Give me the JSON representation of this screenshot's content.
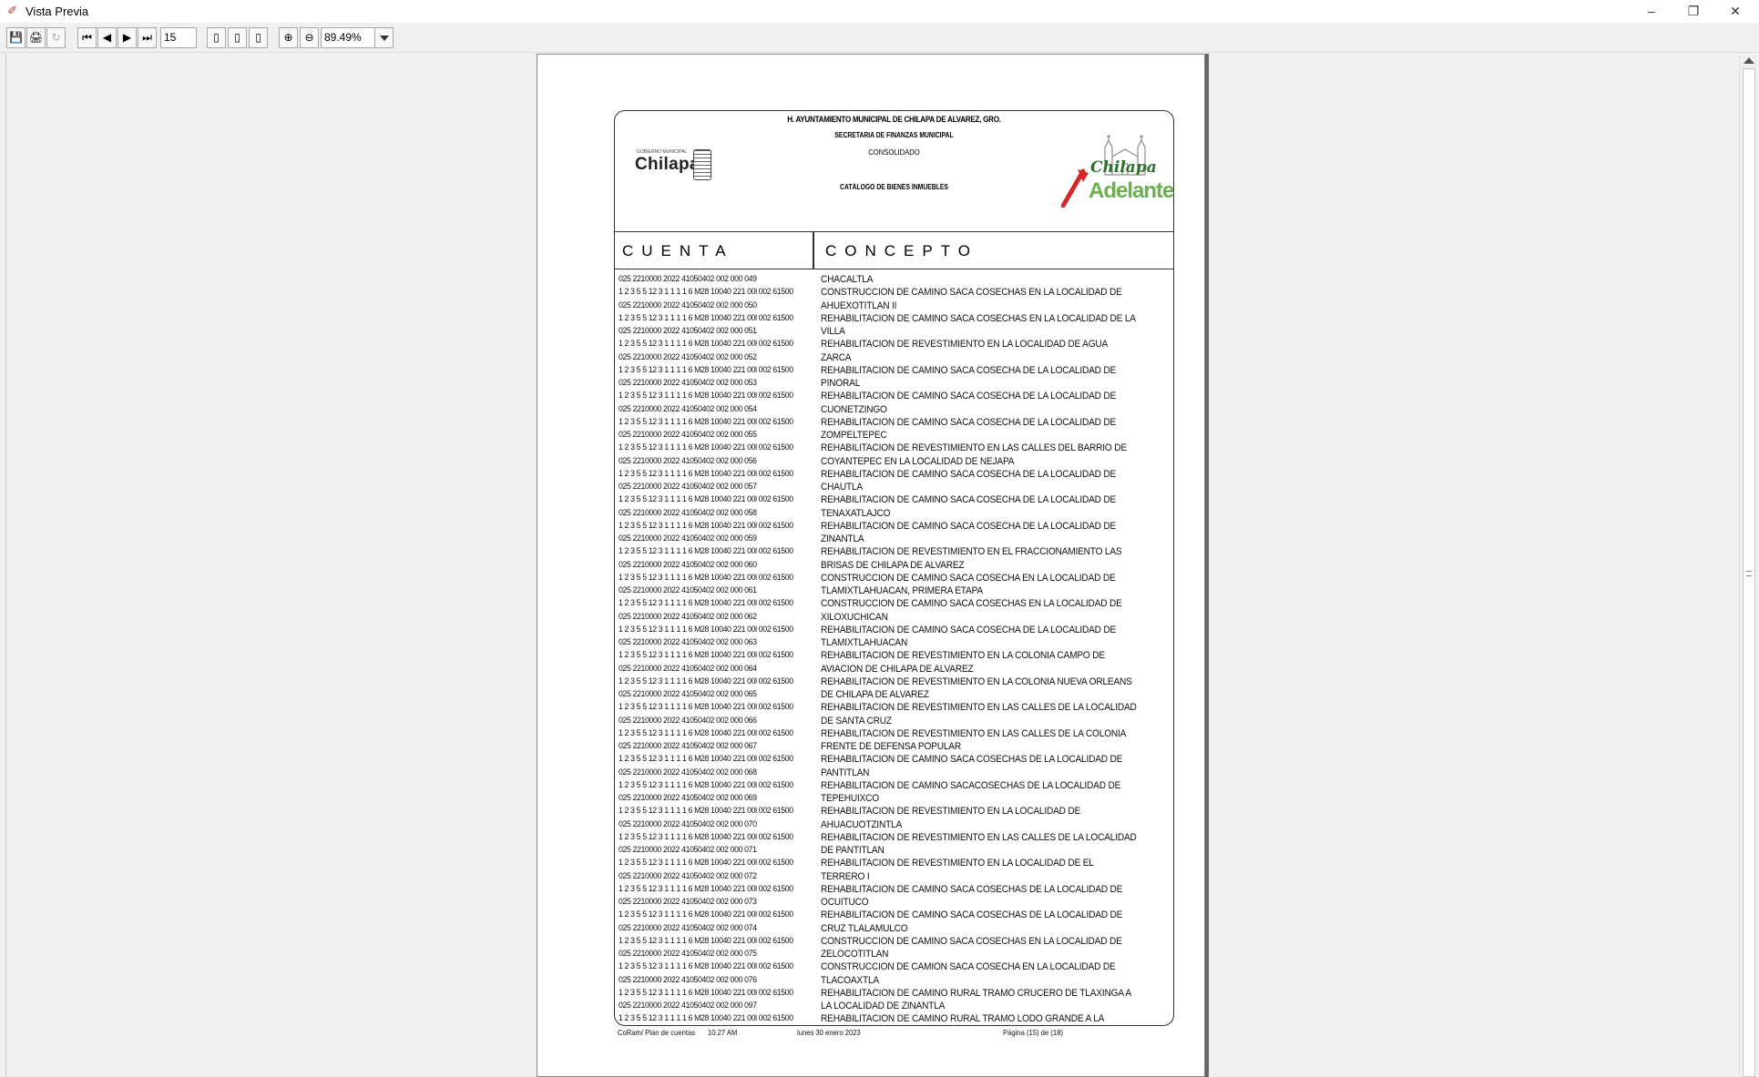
{
  "window": {
    "title": "Vista Previa",
    "minimize": "–",
    "restore": "❐",
    "close": "✕"
  },
  "toolbar": {
    "save": "💾",
    "print": "🖨",
    "refresh": "↻",
    "first": "⏮",
    "prev": "◀",
    "next": "▶",
    "last": "⏭",
    "page_number": "15",
    "single_page": "▯",
    "page_width": "▯",
    "multi_page": "▯",
    "zoom_in": "⊕",
    "zoom_out": "⊖",
    "zoom_value": "89.49%"
  },
  "report": {
    "header_line1": "H. AYUNTAMIENTO MUNICIPAL DE CHILAPA DE ALVAREZ, GRO.",
    "header_line2": "SECRETARIA DE FINANZAS MUNICIPAL",
    "header_line3": "CONSOLIDADO",
    "header_line4": "CATÁLOGO DE BIENES INMUEBLES",
    "logo_left_tagline": "GOBIERNO MUNICIPAL",
    "logo_left_word": "Chilapa",
    "logo_right_script": "Chilapa",
    "logo_right_word": "Adelante",
    "col_cuenta": "CUENTA",
    "col_concepto": "CONCEPTO",
    "rows": [
      {
        "acc1": "025 2210000 2022 41050402 002 000 049",
        "acc2": "1 2 3 5 5 12 3 1 1 1 1 6 M28 10040 221 00l 002 61500",
        "con1": "CHACALTLA",
        "con2": "CONSTRUCCION DE CAMINO SACA COSECHAS EN LA LOCALIDAD DE"
      },
      {
        "acc1": "025 2210000 2022 41050402 002 000 050",
        "acc2": "1 2 3 5 5 12 3 1 1 1 1 6 M28 10040 221 00l 002 61500",
        "con1": "AHUEXOTITLAN II",
        "con2": "REHABILITACION DE CAMINO SACA COSECHAS EN LA LOCALIDAD DE LA"
      },
      {
        "acc1": "025 2210000 2022 41050402 002 000 051",
        "acc2": "1 2 3 5 5 12 3 1 1 1 1 6 M28 10040 221 00l 002 61500",
        "con1": "VILLA",
        "con2": "REHABILITACION DE REVESTIMIENTO EN LA  LOCALIDAD DE AGUA"
      },
      {
        "acc1": "025 2210000 2022 41050402 002 000 052",
        "acc2": "1 2 3 5 5 12 3 1 1 1 1 6 M28 10040 221 00l 002 61500",
        "con1": "ZARCA",
        "con2": "REHABILITACION DE CAMINO SACA COSECHA DE LA LOCALIDAD DE"
      },
      {
        "acc1": "025 2210000 2022 41050402 002 000 053",
        "acc2": "1 2 3 5 5 12 3 1 1 1 1 6 M28 10040 221 00l 002 61500",
        "con1": "PINORAL",
        "con2": "REHABILITACION DE CAMINO SACA COSECHA DE LA LOCALIDAD DE"
      },
      {
        "acc1": "025 2210000 2022 41050402 002 000 054",
        "acc2": "1 2 3 5 5 12 3 1 1 1 1 6 M28 10040 221 00l 002 61500",
        "con1": "CUONETZINGO",
        "con2": "REHABILITACION DE CAMINO SACA COSECHA DE LA LOCALIDAD DE"
      },
      {
        "acc1": "025 2210000 2022 41050402 002 000 055",
        "acc2": "1 2 3 5 5 12 3 1 1 1 1 6 M28 10040 221 00l 002 61500",
        "con1": "ZOMPELTEPEC",
        "con2": "REHABILITACION DE REVESTIMIENTO EN LAS CALLES DEL BARRIO DE"
      },
      {
        "acc1": "025 2210000 2022 41050402 002 000 056",
        "acc2": "1 2 3 5 5 12 3 1 1 1 1 6 M28 10040 221 00l 002 61500",
        "con1": "COYANTEPEC EN LA LOCALIDAD DE NEJAPA",
        "con2": "REHABILITACION DE CAMINO SACA COSECHA DE LA LOCALIDAD DE"
      },
      {
        "acc1": "025 2210000 2022 41050402 002 000 057",
        "acc2": "1 2 3 5 5 12 3 1 1 1 1 6 M28 10040 221 00l 002 61500",
        "con1": "CHAUTLA",
        "con2": "REHABILITACION DE CAMINO SACA COSECHA DE LA LOCALIDAD DE"
      },
      {
        "acc1": "025 2210000 2022 41050402 002 000 058",
        "acc2": "1 2 3 5 5 12 3 1 1 1 1 6 M28 10040 221 00l 002 61500",
        "con1": "TENAXATLAJCO",
        "con2": "REHABILITACION DE CAMINO SACA COSECHA DE LA LOCALIDAD DE"
      },
      {
        "acc1": "025 2210000 2022 41050402 002 000 059",
        "acc2": "1 2 3 5 5 12 3 1 1 1 1 6 M28 10040 221 00l 002 61500",
        "con1": "ZINANTLA",
        "con2": "REHABILITACION DE REVESTIMIENTO EN EL FRACCIONAMIENTO LAS"
      },
      {
        "acc1": "025 2210000 2022 41050402 002 000 060",
        "acc2": "1 2 3 5 5 12 3 1 1 1 1 6 M28 10040 221 00l 002 61500",
        "con1": "BRISAS DE CHILAPA DE ALVAREZ",
        "con2": "CONSTRUCCION DE CAMINO SACA COSECHA EN LA LOCALIDAD DE"
      },
      {
        "acc1": "025 2210000 2022 41050402 002 000 061",
        "acc2": "1 2 3 5 5 12 3 1 1 1 1 6 M28 10040 221 00l 002 61500",
        "con1": "TLAMIXTLAHUACAN, PRIMERA ETAPA",
        "con2": "CONSTRUCCION DE CAMINO SACA COSECHAS EN LA LOCALIDAD DE"
      },
      {
        "acc1": "025 2210000 2022 41050402 002 000 062",
        "acc2": "1 2 3 5 5 12 3 1 1 1 1 6 M28 10040 221 00l 002 61500",
        "con1": "XILOXUCHICAN",
        "con2": "REHABILITACION DE CAMINO SACA COSECHA DE LA LOCALIDAD DE"
      },
      {
        "acc1": "025 2210000 2022 41050402 002 000 063",
        "acc2": "1 2 3 5 5 12 3 1 1 1 1 6 M28 10040 221 00l 002 61500",
        "con1": "TLAMIXTLAHUACAN",
        "con2": "REHABILITACION DE REVESTIMIENTO EN LA COLONIA CAMPO DE"
      },
      {
        "acc1": "025 2210000 2022 41050402 002 000 064",
        "acc2": "1 2 3 5 5 12 3 1 1 1 1 6 M28 10040 221 00l 002 61500",
        "con1": "AVIACION DE CHILAPA DE ALVAREZ",
        "con2": "REHABILITACION DE REVESTIMIENTO EN LA COLONIA NUEVA ORLEANS"
      },
      {
        "acc1": "025 2210000 2022 41050402 002 000 065",
        "acc2": "1 2 3 5 5 12 3 1 1 1 1 6 M28 10040 221 00l 002 61500",
        "con1": "DE CHILAPA DE ALVAREZ",
        "con2": "REHABILITACION DE REVESTIMIENTO EN LAS CALLES DE LA LOCALIDAD"
      },
      {
        "acc1": "025 2210000 2022 41050402 002 000 066",
        "acc2": "1 2 3 5 5 12 3 1 1 1 1 6 M28 10040 221 00l 002 61500",
        "con1": "DE SANTA CRUZ",
        "con2": "REHABILITACION DE REVESTIMIENTO EN LAS CALLES DE LA COLONIA"
      },
      {
        "acc1": "025 2210000 2022 41050402 002 000 067",
        "acc2": "1 2 3 5 5 12 3 1 1 1 1 6 M28 10040 221 00l 002 61500",
        "con1": "FRENTE DE DEFENSA POPULAR",
        "con2": "REHABILITACION DE CAMINO SACA COSECHAS DE LA LOCALIDAD DE"
      },
      {
        "acc1": "025 2210000 2022 41050402 002 000 068",
        "acc2": "1 2 3 5 5 12 3 1 1 1 1 6 M28 10040 221 00l 002 61500",
        "con1": "PANTITLAN",
        "con2": "REHABILITACION DE CAMINO SACACOSECHAS DE LA LOCALIDAD DE"
      },
      {
        "acc1": "025 2210000 2022 41050402 002 000 069",
        "acc2": "1 2 3 5 5 12 3 1 1 1 1 6 M28 10040 221 00l 002 61500",
        "con1": "TEPEHUIXCO",
        "con2": "REHABILITACION DE REVESTIMIENTO EN LA LOCALIDAD DE"
      },
      {
        "acc1": "025 2210000 2022 41050402 002 000 070",
        "acc2": "1 2 3 5 5 12 3 1 1 1 1 6 M28 10040 221 00l 002 61500",
        "con1": "AHUACUOTZINTLA",
        "con2": "REHABILITACION DE REVESTIMIENTO EN LAS CALLES DE LA LOCALIDAD"
      },
      {
        "acc1": "025 2210000 2022 41050402 002 000 071",
        "acc2": "1 2 3 5 5 12 3 1 1 1 1 6 M28 10040 221 00l 002 61500",
        "con1": "DE PANTITLAN",
        "con2": "REHABILITACION DE REVESTIMIENTO EN LA LOCALIDAD DE EL"
      },
      {
        "acc1": "025 2210000 2022 41050402 002 000 072",
        "acc2": "1 2 3 5 5 12 3 1 1 1 1 6 M28 10040 221 00l 002 61500",
        "con1": "TERRERO I",
        "con2": "REHABILITACION DE CAMINO SACA COSECHAS DE LA LOCALIDAD DE"
      },
      {
        "acc1": "025 2210000 2022 41050402 002 000 073",
        "acc2": "1 2 3 5 5 12 3 1 1 1 1 6 M28 10040 221 00l 002 61500",
        "con1": "OCUITUCO",
        "con2": "REHABILITACION DE CAMINO SACA COSECHAS DE LA LOCALIDAD DE"
      },
      {
        "acc1": "025 2210000 2022 41050402 002 000 074",
        "acc2": "1 2 3 5 5 12 3 1 1 1 1 6 M28 10040 221 00l 002 61500",
        "con1": "CRUZ TLALAMULCO",
        "con2": "CONSTRUCCION DE CAMINO SACA COSECHAS EN LA LOCALIDAD DE"
      },
      {
        "acc1": "025 2210000 2022 41050402 002 000 075",
        "acc2": "1 2 3 5 5 12 3 1 1 1 1 6 M28 10040 221 00l 002 61500",
        "con1": "ZELOCOTITLAN",
        "con2": "CONSTRUCCION DE CAMION SACA COSECHA EN LA LOCALIDAD DE"
      },
      {
        "acc1": "025 2210000 2022 41050402 002 000 076",
        "acc2": "1 2 3 5 5 12 3 1 1 1 1 6 M28 10040 221 00l 002 61500",
        "con1": "TLACOAXTLA",
        "con2": "REHABILITACION DE CAMINO RURAL TRAMO CRUCERO DE TLAXINGA A"
      },
      {
        "acc1": "025 2210000 2022 41050402 002 000 097",
        "acc2": "1 2 3 5 5 12 3 1 1 1 1 6 M28 10040 221 00l 002 61500",
        "con1": "LA LOCALIDAD DE ZINANTLA",
        "con2": "REHABILITACION DE CAMINO RURAL TRAMO LODO GRANDE A LA"
      }
    ],
    "footer": {
      "module": "CoRam/ Plan de cuentas",
      "time": "10.27 AM",
      "date": "lunes 30 enero 2023",
      "page": "Página (15) de (18)"
    }
  }
}
